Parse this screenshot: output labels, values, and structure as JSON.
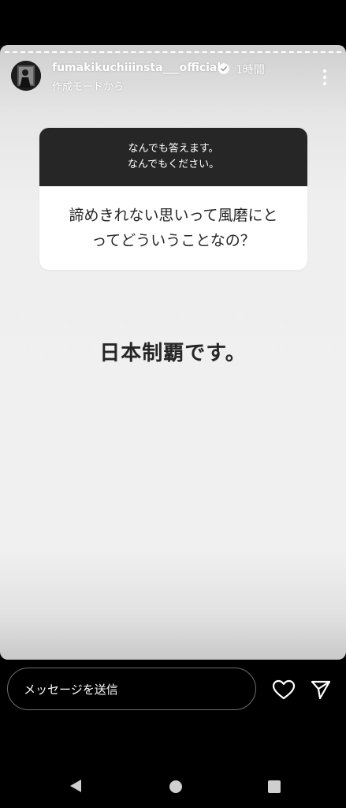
{
  "story": {
    "username": "fumakikuchiiinsta___official",
    "time": "1時間",
    "subtitle": "作成モードから"
  },
  "question_card": {
    "header_lines": [
      "なんでも答えます。",
      "なんでもください。"
    ],
    "question_lines": [
      "諦めきれない思いって風磨にと",
      "ってどういうことなの？"
    ]
  },
  "answer_text": "日本制覇です。",
  "reply": {
    "placeholder": "メッセージを送信"
  },
  "icons": {
    "verified": "verified-badge-icon",
    "more": "more-vertical-icon",
    "heart": "heart-icon",
    "send": "send-paper-plane-icon",
    "back": "back-triangle-icon",
    "home": "home-circle-icon",
    "recents": "recents-square-icon"
  },
  "colors": {
    "story_background": "#f0f0f0",
    "card_header": "#262626",
    "text_dark": "#262626",
    "verified_badge": "#3897f0"
  }
}
